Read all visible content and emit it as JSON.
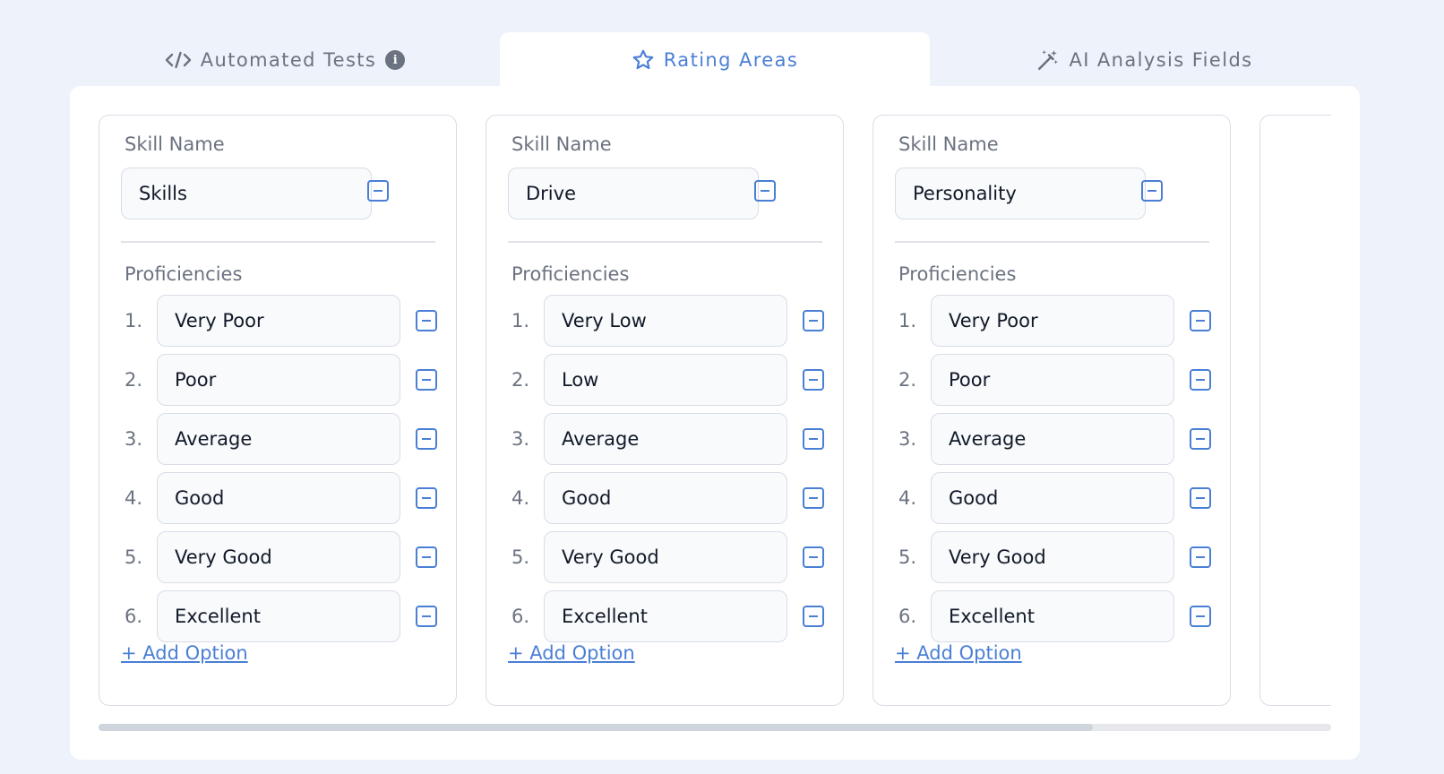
{
  "tabs": [
    {
      "label": "Automated Tests",
      "icon": "code-icon",
      "active": false
    },
    {
      "label": "Rating Areas",
      "icon": "star-icon",
      "active": true
    },
    {
      "label": "AI Analysis Fields",
      "icon": "magic-wand-icon",
      "active": false
    }
  ],
  "colors": {
    "accent": "#4a7fd6",
    "background": "#eef2fa",
    "muted": "#6b7280"
  },
  "skill_cards": [
    {
      "skill_name_label": "Skill Name",
      "skill_name": "Skills",
      "proficiencies_label": "Proficiencies",
      "proficiencies": [
        {
          "num": "1.",
          "value": "Very Poor"
        },
        {
          "num": "2.",
          "value": "Poor"
        },
        {
          "num": "3.",
          "value": "Average"
        },
        {
          "num": "4.",
          "value": "Good"
        },
        {
          "num": "5.",
          "value": "Very Good"
        },
        {
          "num": "6.",
          "value": "Excellent"
        }
      ],
      "add_option": "+ Add Option"
    },
    {
      "skill_name_label": "Skill Name",
      "skill_name": "Drive",
      "proficiencies_label": "Proficiencies",
      "proficiencies": [
        {
          "num": "1.",
          "value": "Very Low"
        },
        {
          "num": "2.",
          "value": "Low"
        },
        {
          "num": "3.",
          "value": "Average"
        },
        {
          "num": "4.",
          "value": "Good"
        },
        {
          "num": "5.",
          "value": "Very Good"
        },
        {
          "num": "6.",
          "value": "Excellent"
        }
      ],
      "add_option": "+ Add Option"
    },
    {
      "skill_name_label": "Skill Name",
      "skill_name": "Personality",
      "proficiencies_label": "Proficiencies",
      "proficiencies": [
        {
          "num": "1.",
          "value": "Very Poor"
        },
        {
          "num": "2.",
          "value": "Poor"
        },
        {
          "num": "3.",
          "value": "Average"
        },
        {
          "num": "4.",
          "value": "Good"
        },
        {
          "num": "5.",
          "value": "Very Good"
        },
        {
          "num": "6.",
          "value": "Excellent"
        }
      ],
      "add_option": "+ Add Option"
    }
  ],
  "scroll": {
    "position_fraction": 0.0,
    "visible_fraction": 0.8
  }
}
